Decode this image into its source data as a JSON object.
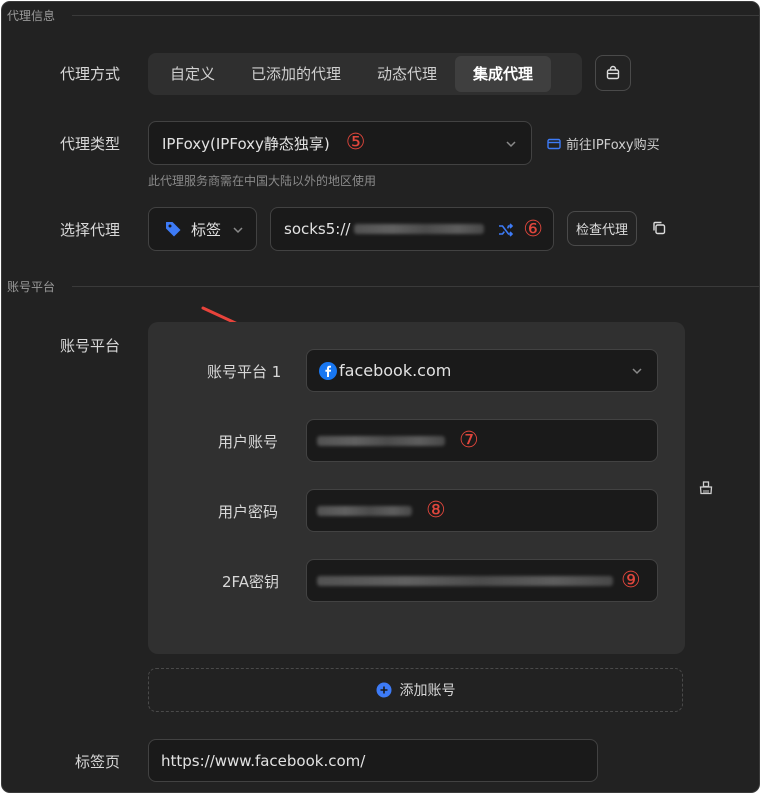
{
  "proxy_section": {
    "title": "代理信息",
    "proxy_mode_label": "代理方式",
    "modes": [
      "自定义",
      "已添加的代理",
      "动态代理",
      "集成代理"
    ],
    "active_mode": "集成代理",
    "proxy_type_label": "代理类型",
    "proxy_type_value": "IPFoxy(IPFoxy静态独享)",
    "proxy_type_marker": "⑤",
    "buy_link": "前往IPFoxy购买",
    "hint": "此代理服务商需在中国大陆以外的地区使用",
    "select_proxy_label": "选择代理",
    "tag_select_value": "标签",
    "proxy_value": "socks5://",
    "proxy_marker": "⑥",
    "check_button": "检查代理"
  },
  "account_section": {
    "title": "账号平台",
    "label": "账号平台",
    "platform_label": "账号平台 1",
    "platform_value": "facebook.com",
    "username_label": "用户账号",
    "username_marker": "⑦",
    "password_label": "用户密码",
    "password_marker": "⑧",
    "twofa_label": "2FA密钥",
    "twofa_marker": "⑨",
    "add_account": "添加账号"
  },
  "tab_label": "标签页",
  "tab_url": "https://www.facebook.com/",
  "colors": {
    "background": "#222222",
    "field": "#1a1a1a",
    "card": "#303030",
    "accent_blue": "#3d7bf7",
    "marker_red": "#e0463c",
    "arrow_red": "#e8433b",
    "facebook_blue": "#1877f2"
  },
  "icons": [
    "bag-icon",
    "chevron-down-icon",
    "wallet-icon",
    "tag-icon",
    "shuffle-icon",
    "copy-icon",
    "facebook-icon",
    "clear-icon",
    "plus-circle-icon",
    "arrow-annotation"
  ]
}
